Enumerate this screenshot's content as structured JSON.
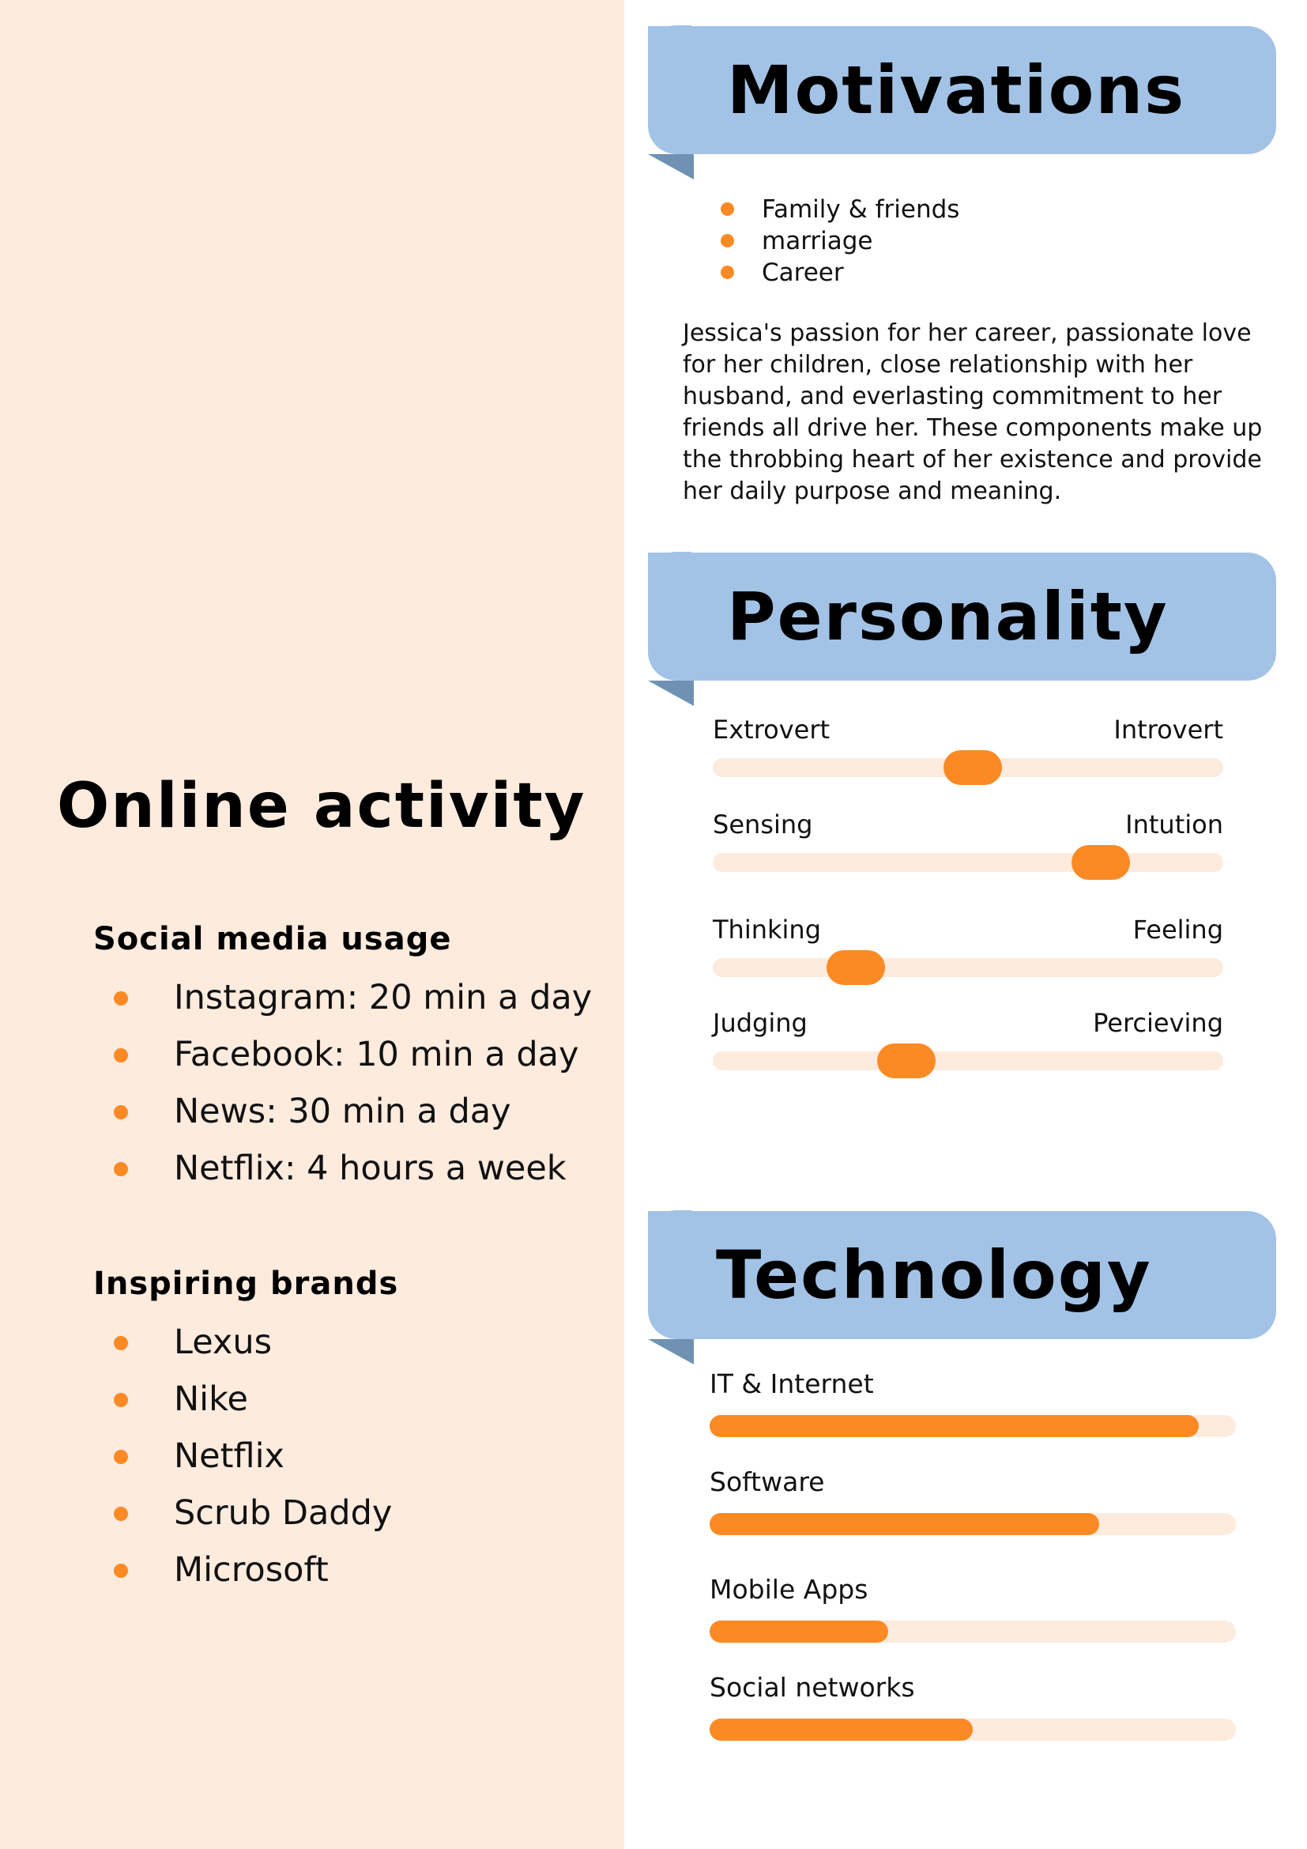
{
  "online": {
    "title": "Online activity",
    "social": {
      "heading": "Social media usage",
      "items": [
        "Instagram: 20 min a day",
        "Facebook: 10 min a day",
        "News: 30 min a day",
        "Netflix: 4 hours a week"
      ]
    },
    "brands": {
      "heading": "Inspiring brands",
      "items": [
        "Lexus",
        "Nike",
        "Netflix",
        "Scrub Daddy",
        "Microsoft"
      ]
    }
  },
  "motivations": {
    "title": "Motivations",
    "items": [
      "Family & friends",
      "marriage",
      "Career"
    ],
    "text": "Jessica's passion for her career, passionate love for her children, close relationship with her husband, and everlasting commitment to her friends all drive her. These components make up the throbbing heart of her existence and provide her daily purpose and meaning."
  },
  "personality": {
    "title": "Personality",
    "traits": [
      {
        "left": "Extrovert",
        "right": "Introvert",
        "level": 0.51
      },
      {
        "left": "Sensing",
        "right": "Intution",
        "level": 0.76
      },
      {
        "left": "Thinking",
        "right": "Feeling",
        "level": 0.28
      },
      {
        "left": "Judging",
        "right": "Percieving",
        "level": 0.38
      }
    ]
  },
  "technology": {
    "title": "Technology",
    "items": [
      {
        "label": "IT & Internet",
        "level": 0.93
      },
      {
        "label": "Software",
        "level": 0.74
      },
      {
        "label": "Mobile Apps",
        "level": 0.34
      },
      {
        "label": "Social networks",
        "level": 0.5
      }
    ]
  },
  "colors": {
    "left_panel": "#fdebde",
    "banner": "#a2c3e6",
    "banner_fold": "#6f92b3",
    "accent": "#fb8a24"
  }
}
